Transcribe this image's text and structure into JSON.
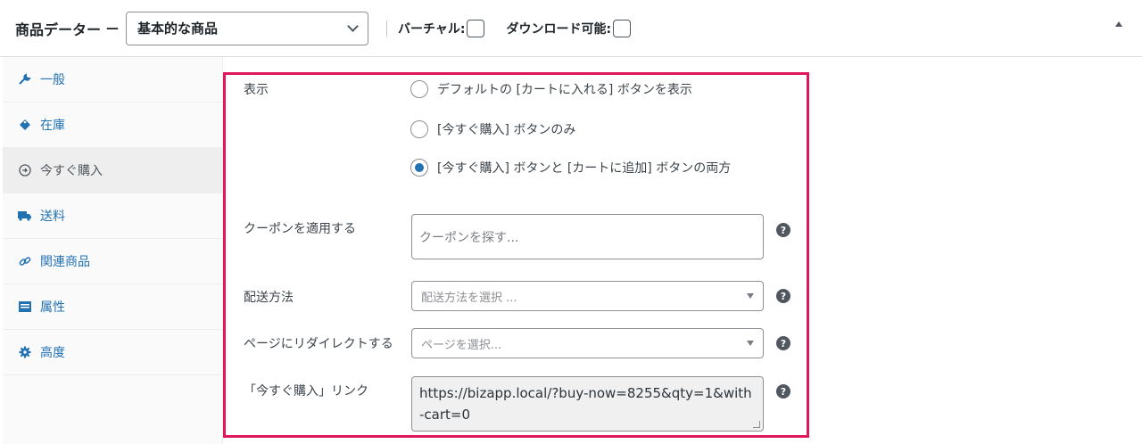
{
  "header": {
    "title": "商品データー",
    "dash": "—",
    "product_type": "基本的な商品",
    "virtual_label": "バーチャル:",
    "downloadable_label": "ダウンロード可能:"
  },
  "sidebar": {
    "items": [
      {
        "label": "一般",
        "icon": "wrench-icon"
      },
      {
        "label": "在庫",
        "icon": "tag-icon"
      },
      {
        "label": "今すぐ購入",
        "icon": "circle-arrow-icon"
      },
      {
        "label": "送料",
        "icon": "truck-icon"
      },
      {
        "label": "関連商品",
        "icon": "link-icon"
      },
      {
        "label": "属性",
        "icon": "list-icon"
      },
      {
        "label": "高度",
        "icon": "gear-icon"
      }
    ],
    "active_index": 2
  },
  "main": {
    "display_label": "表示",
    "radio_options": [
      "デフォルトの [カートに入れる] ボタンを表示",
      "[今すぐ購入] ボタンのみ",
      "[今すぐ購入] ボタンと [カートに追加] ボタンの両方"
    ],
    "radio_selected": 2,
    "coupon_label": "クーポンを適用する",
    "coupon_placeholder": "クーポンを探す...",
    "shipping_label": "配送方法",
    "shipping_placeholder": "配送方法を選択 ...",
    "redirect_label": "ページにリダイレクトする",
    "redirect_placeholder": "ページを選択...",
    "link_label": "「今すぐ購入」リンク",
    "link_value": "https://bizapp.local/?buy-now=8255&qty=1&with-cart=0",
    "help_glyph": "?"
  },
  "colors": {
    "accent": "#2271b1",
    "highlight_border": "#e0175a"
  }
}
